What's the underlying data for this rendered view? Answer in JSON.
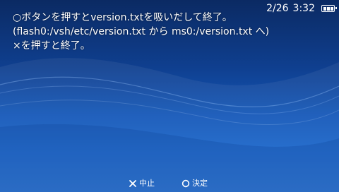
{
  "message": {
    "line1": "○ボタンを押すとversion.txtを吸いだして終了。",
    "line2": "(flash0:/vsh/etc/version.txt から ms0:/version.txt へ)",
    "line3": "×を押すと終了。"
  },
  "status": {
    "date": "2/26",
    "time": "3:32",
    "battery_level": 1.0
  },
  "controls": {
    "cancel_label": "中止",
    "confirm_label": "決定"
  },
  "icons": {
    "cancel": "cross-icon",
    "confirm": "circle-icon",
    "battery": "battery-icon"
  },
  "colors": {
    "background_top": "#0b2a63",
    "background_bottom": "#2a73d2",
    "text": "#ffffff"
  }
}
